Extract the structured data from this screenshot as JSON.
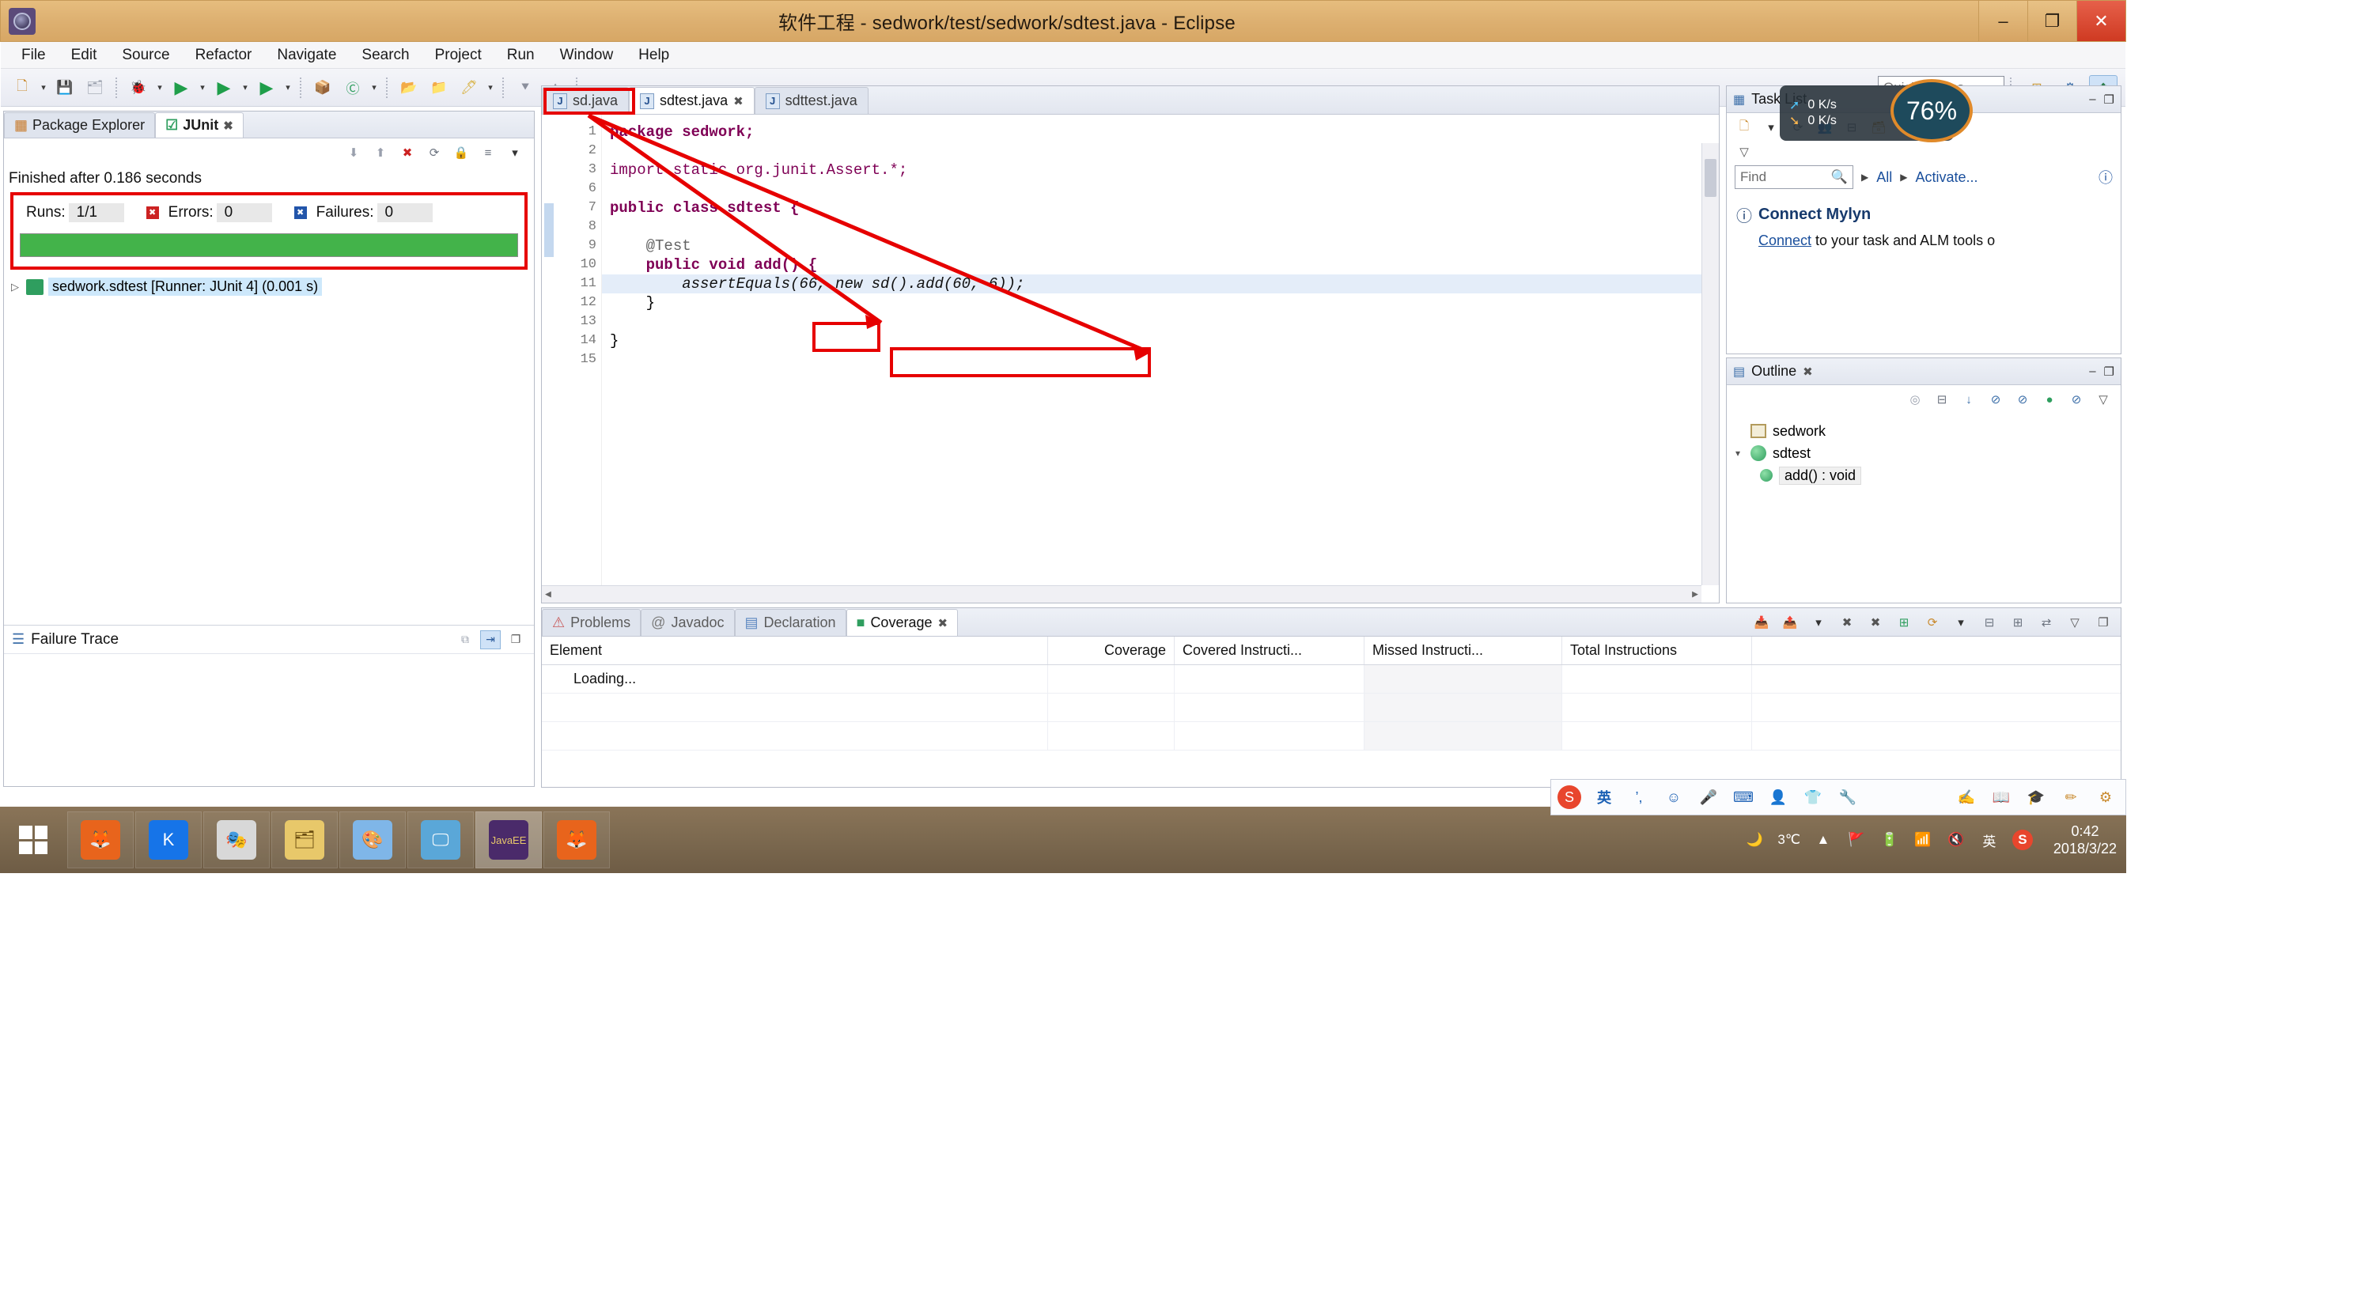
{
  "window": {
    "title": "软件工程 - sedwork/test/sedwork/sdtest.java - Eclipse",
    "app_icon": "eclipse-icon",
    "buttons": {
      "minimize": "–",
      "maximize": "❐",
      "close": "✕"
    }
  },
  "menu": {
    "items": [
      "File",
      "Edit",
      "Source",
      "Refactor",
      "Navigate",
      "Search",
      "Project",
      "Run",
      "Window",
      "Help"
    ]
  },
  "toolbar": {
    "quick_access_placeholder": "Quick Access",
    "icons": [
      {
        "name": "new-wizard-icon",
        "glyph": "🗋"
      },
      {
        "name": "save-icon",
        "glyph": "💾"
      },
      {
        "name": "save-all-icon",
        "glyph": "🗂"
      },
      {
        "name": "debug-icon",
        "glyph": "🐞"
      },
      {
        "name": "run-icon",
        "glyph": "▶"
      },
      {
        "name": "coverage-icon",
        "glyph": "▶"
      },
      {
        "name": "run-last-icon",
        "glyph": "▶"
      },
      {
        "name": "new-java-project-icon",
        "glyph": "📦"
      },
      {
        "name": "new-class-icon",
        "glyph": "Ⓒ"
      },
      {
        "name": "open-type-icon",
        "glyph": "📂"
      },
      {
        "name": "open-task-icon",
        "glyph": "📁"
      },
      {
        "name": "toggle-mark-icon",
        "glyph": "🖊"
      },
      {
        "name": "next-annotation-icon",
        "glyph": "⯆"
      },
      {
        "name": "previous-annotation-icon",
        "glyph": "⯅"
      },
      {
        "name": "back-icon",
        "glyph": "←"
      },
      {
        "name": "forward-icon",
        "glyph": "→"
      }
    ],
    "perspective_buttons": [
      {
        "name": "open-perspective-icon",
        "glyph": "⊞",
        "active": false
      },
      {
        "name": "java-perspective-icon",
        "glyph": "⚙",
        "active": false
      },
      {
        "name": "java-ee-perspective-icon",
        "glyph": "❖",
        "active": true
      }
    ]
  },
  "junit": {
    "tabs": [
      {
        "label": "Package Explorer",
        "icon": "package-explorer-icon",
        "active": false,
        "closable": false
      },
      {
        "label": "JUnit",
        "icon": "junit-icon",
        "active": true,
        "closable": true,
        "close_glyph": "✖"
      }
    ],
    "toolbar_icons": [
      {
        "name": "next-failure-icon",
        "glyph": "⬇"
      },
      {
        "name": "previous-failure-icon",
        "glyph": "⬆"
      },
      {
        "name": "show-failures-only-icon",
        "glyph": "✖"
      },
      {
        "name": "rerun-test-icon",
        "glyph": "⟳"
      },
      {
        "name": "lock-icon",
        "glyph": "🔒"
      },
      {
        "name": "scroll-lock-icon",
        "glyph": "≡"
      },
      {
        "name": "view-menu-icon",
        "glyph": "▾"
      }
    ],
    "finished_text": "Finished after 0.186 seconds",
    "stats": {
      "runs_label": "Runs:",
      "runs_value": "1/1",
      "errors_label": "Errors:",
      "errors_value": "0",
      "errors_badge": "✖",
      "failures_label": "Failures:",
      "failures_value": "0",
      "failures_badge": "✖"
    },
    "progress_color": "#43b34a",
    "highlight_color": "#e60000",
    "tree": [
      {
        "arrow": "▷",
        "label": "sedwork.sdtest [Runner: JUnit 4] (0.001 s)"
      }
    ],
    "failure_trace": {
      "title": "Failure Trace",
      "icon": "failure-trace-icon",
      "actions": [
        {
          "name": "compare-result-icon",
          "glyph": "⧉",
          "active": false
        },
        {
          "name": "filter-stack-trace-icon",
          "glyph": "⇥",
          "active": true
        },
        {
          "name": "view-menu-icon",
          "glyph": "❐",
          "active": false
        }
      ]
    }
  },
  "editor": {
    "tabs": [
      {
        "label": "sd.java",
        "icon": "java-file-icon",
        "active": false,
        "highlighted": true
      },
      {
        "label": "sdtest.java",
        "icon": "java-file-icon",
        "active": true,
        "close_glyph": "✖"
      },
      {
        "label": "sdttest.java",
        "icon": "java-file-icon",
        "active": false
      }
    ],
    "line_numbers": [
      "1",
      "2",
      "3",
      "6",
      "7",
      "8",
      "9",
      "10",
      "11",
      "12",
      "13",
      "14",
      "15"
    ],
    "lines": [
      {
        "n": "1",
        "text": "package sedwork;",
        "kw": "package",
        "highlight": false
      },
      {
        "n": "2",
        "text": "",
        "highlight": false
      },
      {
        "n": "3",
        "text": "import static org.junit.Assert.*;",
        "fold": "⊕",
        "highlight": false
      },
      {
        "n": "6",
        "text": "",
        "highlight": false
      },
      {
        "n": "7",
        "text": "public class sdtest {",
        "highlight": false
      },
      {
        "n": "8",
        "text": "",
        "highlight": false
      },
      {
        "n": "9",
        "text": "    @Test",
        "fold": "⊖",
        "highlight": false
      },
      {
        "n": "10",
        "text": "    public void add() {",
        "highlight": false
      },
      {
        "n": "11",
        "text": "        assertEquals(66, new sd().add(60, 6));",
        "highlight": true
      },
      {
        "n": "12",
        "text": "    }",
        "highlight": false
      },
      {
        "n": "13",
        "text": "",
        "highlight": false
      },
      {
        "n": "14",
        "text": "}",
        "highlight": false
      },
      {
        "n": "15",
        "text": "",
        "highlight": false
      }
    ],
    "annotations": {
      "box_tab": "sd.java",
      "box_method": "add()",
      "box_call": "new sd().add(60, 6))",
      "arrow_color": "#e60000"
    }
  },
  "tasklist": {
    "title": "Task List",
    "icon": "task-list-icon",
    "min_glyph": "–",
    "max_glyph": "❐",
    "toolbar_icons": [
      {
        "name": "new-task-icon",
        "glyph": "🗋"
      },
      {
        "name": "new-task-dropdown-icon",
        "glyph": "▾"
      },
      {
        "name": "synchronize-icon",
        "glyph": "⟳"
      },
      {
        "name": "focus-on-workweek-icon",
        "glyph": "👥"
      },
      {
        "name": "collapse-all-icon",
        "glyph": "⊟"
      },
      {
        "name": "view-menu-icon",
        "glyph": "🗃"
      },
      {
        "name": "more-icon",
        "glyph": "▽"
      }
    ],
    "find_placeholder": "Find",
    "find_icon": "search-icon",
    "scope_label": "All",
    "activate_label": "Activate...",
    "help_icon": "help-icon",
    "mylyn": {
      "info_icon": "info-icon",
      "title": "Connect Mylyn",
      "link": "Connect",
      "text": " to your task and ALM tools o"
    }
  },
  "net_widget": {
    "upload": "0 K/s",
    "download": "0 K/s",
    "cpu_percent": "76%",
    "up_icon": "upload-arrow-icon",
    "down_icon": "download-arrow-icon"
  },
  "outline": {
    "title": "Outline",
    "icon": "outline-icon",
    "close_glyph": "✖",
    "min_glyph": "–",
    "max_glyph": "❐",
    "toolbar_icons": [
      {
        "name": "focus-on-active-task-icon",
        "glyph": "◎"
      },
      {
        "name": "collapse-all-icon",
        "glyph": "⊟"
      },
      {
        "name": "sort-icon",
        "glyph": "↓"
      },
      {
        "name": "hide-fields-icon",
        "glyph": "⊘"
      },
      {
        "name": "hide-static-icon",
        "glyph": "⊘"
      },
      {
        "name": "hide-nonpublic-icon",
        "glyph": "●"
      },
      {
        "name": "hide-local-types-icon",
        "glyph": "⊘"
      },
      {
        "name": "view-menu-icon",
        "glyph": "▽"
      }
    ],
    "tree": [
      {
        "label": "sedwork",
        "kind": "package",
        "arrow": "",
        "selected": false
      },
      {
        "label": "sdtest",
        "kind": "class",
        "arrow": "▾",
        "selected": false
      },
      {
        "label": "add() : void",
        "kind": "method",
        "arrow": "",
        "selected": true
      }
    ]
  },
  "bottom": {
    "tabs": [
      {
        "label": "Problems",
        "icon": "problems-icon",
        "active": false
      },
      {
        "label": "Javadoc",
        "icon": "javadoc-icon",
        "active": false
      },
      {
        "label": "Declaration",
        "icon": "declaration-icon",
        "active": false
      },
      {
        "label": "Coverage",
        "icon": "coverage-icon",
        "active": true,
        "close_glyph": "✖"
      }
    ],
    "actions": [
      {
        "name": "import-session-icon",
        "glyph": "📥"
      },
      {
        "name": "export-session-icon",
        "glyph": "📤"
      },
      {
        "name": "session-dropdown-icon",
        "glyph": "▾"
      },
      {
        "name": "remove-session-icon",
        "glyph": "✖"
      },
      {
        "name": "remove-all-sessions-icon",
        "glyph": "✖"
      },
      {
        "name": "merge-sessions-icon",
        "glyph": "⊞"
      },
      {
        "name": "relaunch-coverage-icon",
        "glyph": "⟳"
      },
      {
        "name": "relaunch-dropdown-icon",
        "glyph": "▾"
      },
      {
        "name": "collapse-all-icon",
        "glyph": "⊟"
      },
      {
        "name": "expand-all-icon",
        "glyph": "⊞"
      },
      {
        "name": "link-with-selection-icon",
        "glyph": "⇄"
      },
      {
        "name": "view-menu-icon",
        "glyph": "▽"
      },
      {
        "name": "maximize-icon",
        "glyph": "❐"
      }
    ],
    "columns": [
      "Element",
      "Coverage",
      "Covered Instructi...",
      "Missed Instructi...",
      "Total Instructions"
    ],
    "rows": [
      [
        "Loading...",
        "",
        "",
        "",
        ""
      ],
      [
        "",
        "",
        "",
        "",
        ""
      ],
      [
        "",
        "",
        "",
        "",
        ""
      ]
    ]
  },
  "ime": {
    "icons": [
      {
        "name": "sogou-logo-icon",
        "glyph": "S"
      },
      {
        "name": "chinese-english-toggle-icon",
        "glyph": "英"
      },
      {
        "name": "punctuation-icon",
        "glyph": "’,"
      },
      {
        "name": "emoji-icon",
        "glyph": "☺"
      },
      {
        "name": "voice-input-icon",
        "glyph": "🎤"
      },
      {
        "name": "soft-keyboard-icon",
        "glyph": "⌨"
      },
      {
        "name": "user-center-icon",
        "glyph": "👤"
      },
      {
        "name": "skin-icon",
        "glyph": "👕"
      },
      {
        "name": "toolbox-icon",
        "glyph": "🔧"
      }
    ],
    "right_icons": [
      {
        "name": "hand-icon",
        "glyph": "✍"
      },
      {
        "name": "dictionary-icon",
        "glyph": "📖"
      },
      {
        "name": "graduation-icon",
        "glyph": "🎓"
      },
      {
        "name": "pencil-icon",
        "glyph": "✏"
      },
      {
        "name": "settings-icon",
        "glyph": "⚙"
      }
    ]
  },
  "taskbar": {
    "start_icon": "windows-start-icon",
    "apps": [
      {
        "name": "firefox-icon",
        "glyph": "🦊",
        "color": "#e8641c",
        "selected": false
      },
      {
        "name": "kugou-icon",
        "glyph": "K",
        "color": "#1674e8",
        "selected": false
      },
      {
        "name": "mask-app-icon",
        "glyph": "🎭",
        "color": "#d8d8d8",
        "selected": false
      },
      {
        "name": "file-explorer-icon",
        "glyph": "🗂",
        "color": "#e8c86a",
        "selected": false
      },
      {
        "name": "paint-icon",
        "glyph": "🎨",
        "color": "#7fb6e8",
        "selected": false
      },
      {
        "name": "media-app-icon",
        "glyph": "🖵",
        "color": "#5aa7d8",
        "selected": false
      },
      {
        "name": "eclipse-javaee-icon",
        "glyph": "JavaEE",
        "color": "#4a2a6a",
        "selected": true
      },
      {
        "name": "firefox-icon",
        "glyph": "🦊",
        "color": "#e8641c",
        "selected": false
      }
    ],
    "tray": [
      {
        "name": "weather-moon-icon",
        "glyph": "🌙"
      },
      {
        "name": "temperature-label",
        "glyph": "3℃"
      },
      {
        "name": "show-hidden-icons-icon",
        "glyph": "▲"
      },
      {
        "name": "action-center-icon",
        "glyph": "🚩"
      },
      {
        "name": "battery-icon",
        "glyph": "🔋"
      },
      {
        "name": "network-signal-icon",
        "glyph": "📶"
      },
      {
        "name": "volume-muted-icon",
        "glyph": "🔇"
      },
      {
        "name": "ime-chinese-icon",
        "glyph": "英"
      },
      {
        "name": "sogou-tray-icon",
        "glyph": "S"
      }
    ],
    "clock_time": "0:42",
    "clock_date": "2018/3/22"
  }
}
